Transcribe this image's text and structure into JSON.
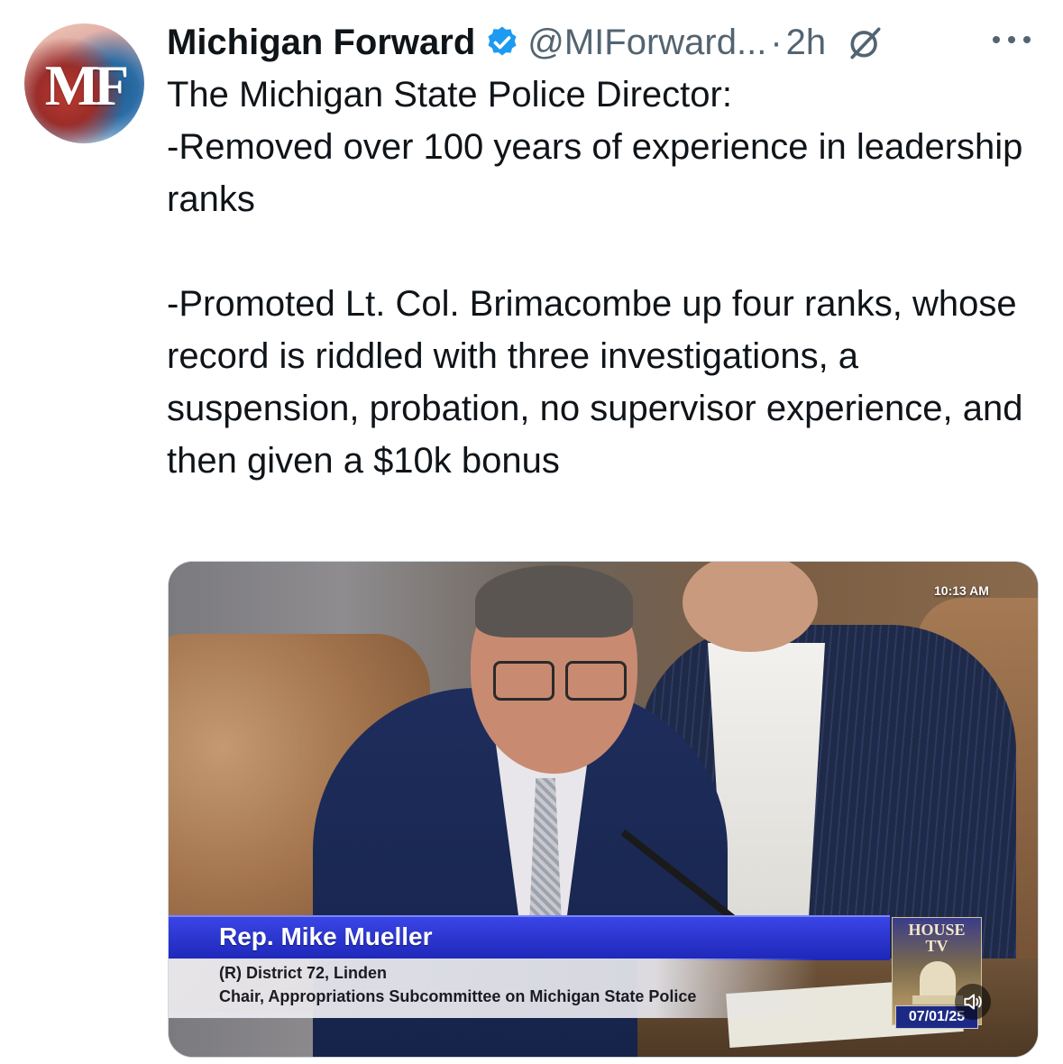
{
  "tweet": {
    "author_name": "Michigan Forward",
    "avatar_initials": "MF",
    "handle": "@MIForward...",
    "separator": "·",
    "time": "2h",
    "body": "The Michigan State Police Director:\n-Removed over 100 years of experience in leadership ranks\n\n-Promoted Lt. Col. Brimacombe up four ranks, whose record is riddled with three investigations, a suspension, probation, no supervisor experience, and then given a $10k bonus"
  },
  "media": {
    "clock": "10:13 AM",
    "lower_third_name": "Rep. Mike Mueller",
    "lower_third_line1": "(R) District 72, Linden",
    "lower_third_line2": "Chair, Appropriations Subcommittee on Michigan State Police",
    "channel_logo_line1": "HOUSE",
    "channel_logo_line2": "TV",
    "date": "07/01/25"
  },
  "icons": {
    "verified": "verified-badge-icon",
    "grok": "grok-icon",
    "more": "more-icon",
    "sound": "sound-icon"
  },
  "colors": {
    "verified": "#1d9bf0",
    "secondary_text": "#536471",
    "lower_third_bar": "#2a35d0"
  }
}
